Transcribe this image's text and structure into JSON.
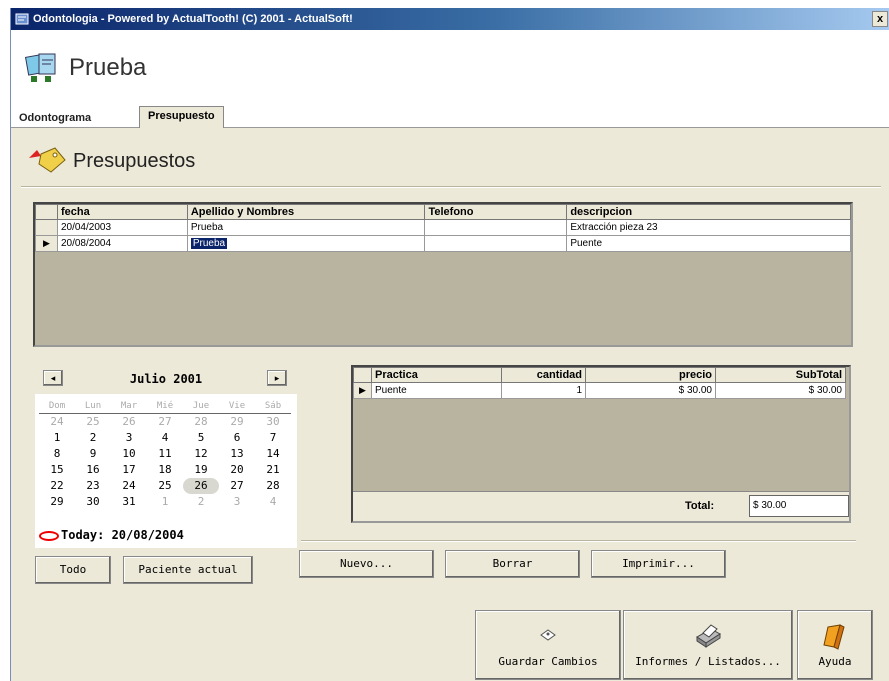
{
  "window": {
    "title": "Odontologia - Powered by ActualTooth! (C) 2001 - ActualSoft!",
    "close_glyph": "x"
  },
  "patient": {
    "name": "Prueba"
  },
  "tabs": [
    {
      "label": "Odontograma"
    },
    {
      "label": "Presupuesto"
    }
  ],
  "section": {
    "title": "Presupuestos"
  },
  "budgets": {
    "columns": [
      "fecha",
      "Apellido y Nombres",
      "Telefono",
      "descripcion"
    ],
    "rows": [
      {
        "indicator": "",
        "fecha": "20/04/2003",
        "nombre": "Prueba",
        "telefono": "",
        "descripcion": "Extracción pieza 23"
      },
      {
        "indicator": "▶",
        "fecha": "20/08/2004",
        "nombre": "Prueba",
        "telefono": "",
        "descripcion": "Puente"
      }
    ]
  },
  "calendar": {
    "prev": "◂",
    "next": "▸",
    "month": "Julio 2001",
    "weekdays": [
      "Dom",
      "Lun",
      "Mar",
      "Mié",
      "Jue",
      "Vie",
      "Sáb"
    ],
    "weeks": [
      [
        "24",
        "25",
        "26",
        "27",
        "28",
        "29",
        "30"
      ],
      [
        "1",
        "2",
        "3",
        "4",
        "5",
        "6",
        "7"
      ],
      [
        "8",
        "9",
        "10",
        "11",
        "12",
        "13",
        "14"
      ],
      [
        "15",
        "16",
        "17",
        "18",
        "19",
        "20",
        "21"
      ],
      [
        "22",
        "23",
        "24",
        "25",
        "26",
        "27",
        "28"
      ],
      [
        "29",
        "30",
        "31",
        "1",
        "2",
        "3",
        "4"
      ]
    ],
    "today_label": "Today: 20/08/2004"
  },
  "buttons": {
    "todo": "Todo",
    "paciente": "Paciente actual",
    "nuevo": "Nuevo...",
    "borrar": "Borrar",
    "imprimir": "Imprimir..."
  },
  "practices": {
    "columns": [
      "Practica",
      "cantidad",
      "precio",
      "SubTotal"
    ],
    "rows": [
      {
        "indicator": "▶",
        "practica": "Puente",
        "cantidad": "1",
        "precio": "$ 30.00",
        "subtotal": "$ 30.00"
      }
    ],
    "total_label": "Total:",
    "total_value": "$ 30.00"
  },
  "footer": {
    "guardar": "Guardar Cambios",
    "informes": "Informes / Listados...",
    "ayuda": "Ayuda"
  }
}
